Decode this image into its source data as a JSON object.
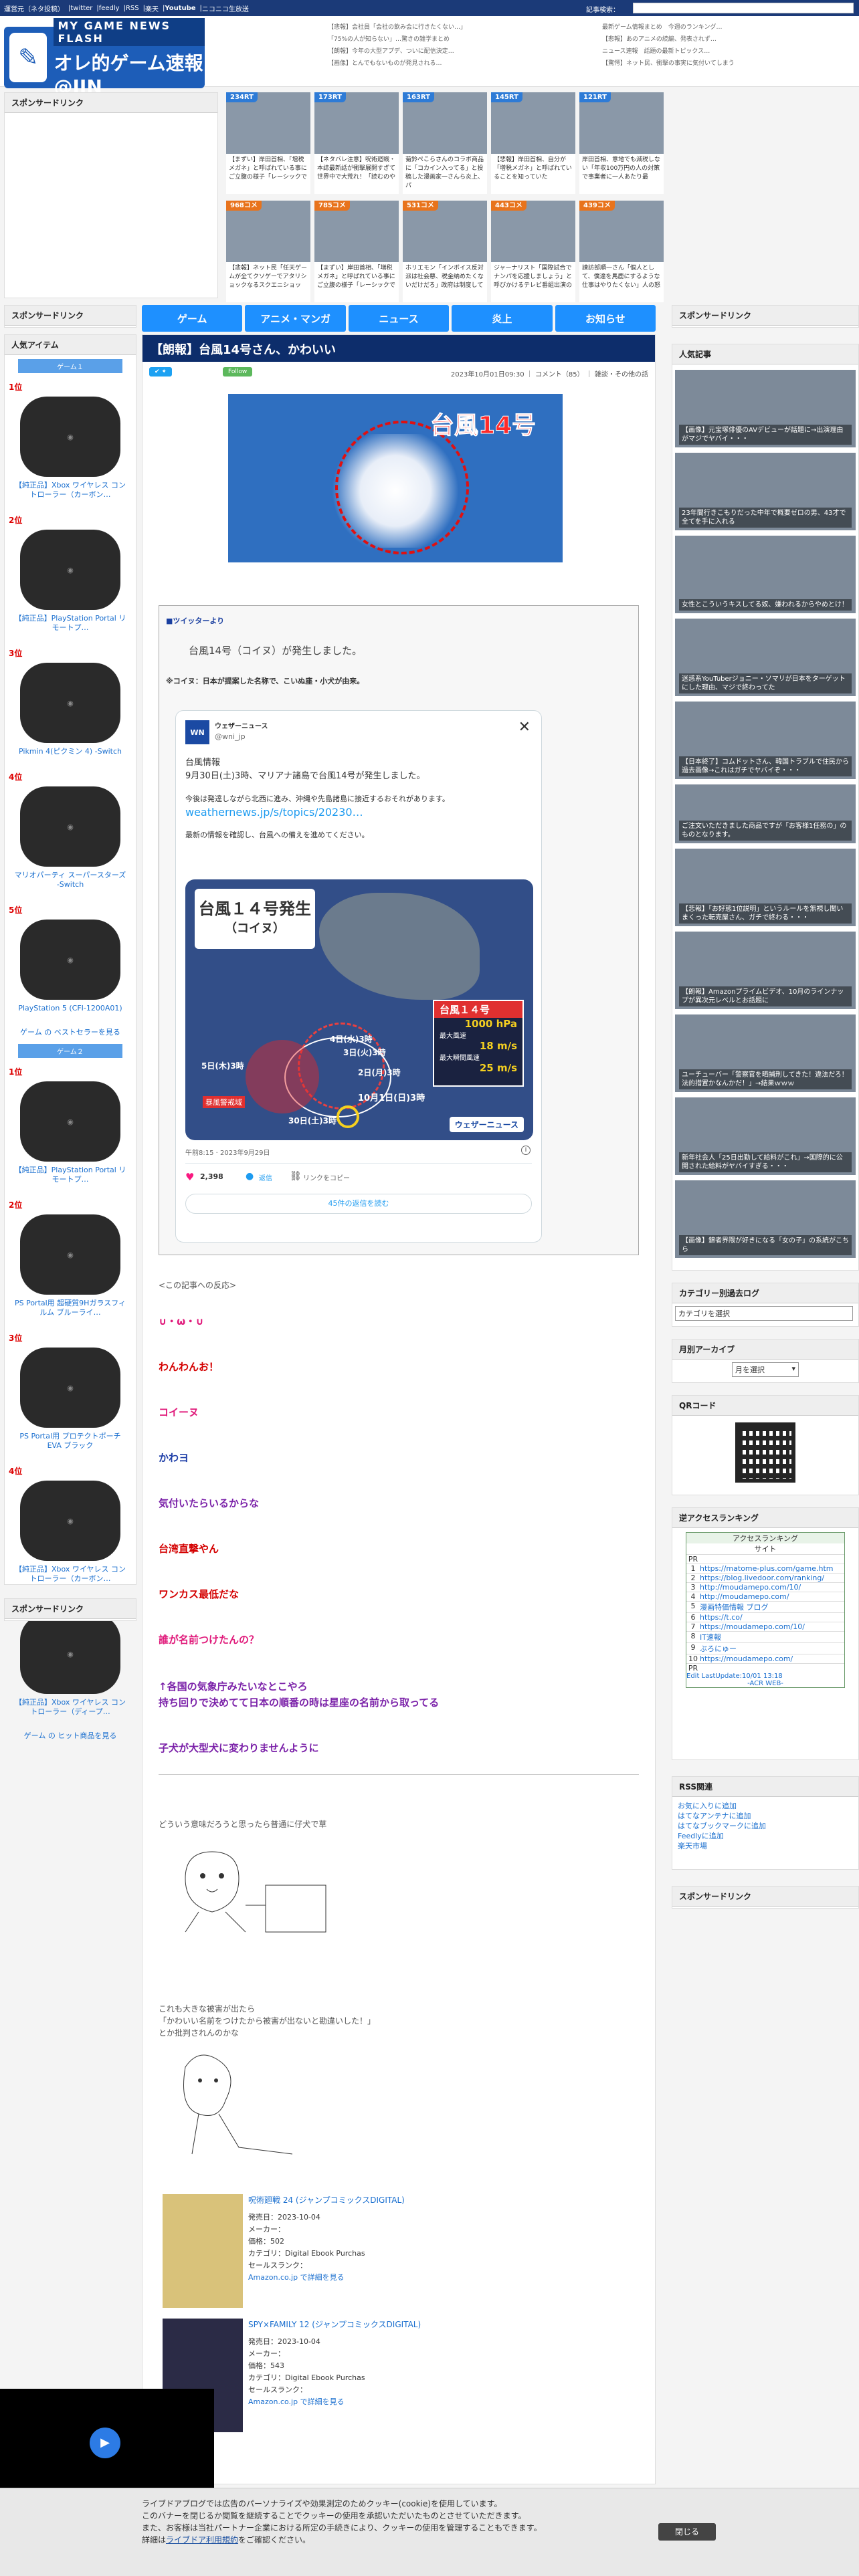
{
  "topbar": {
    "links": [
      "運営元（ネタ投稿）",
      "twitter",
      "feedly",
      "RSS",
      "楽天",
      "Youtube",
      "ニコニコ生放送"
    ],
    "search_label": "記事検索："
  },
  "logo": {
    "line1": "MY GAME NEWS FLASH",
    "line2": "オレ的ゲーム速報@JIN"
  },
  "header_links": [
    "【悲報】会社員「会社の飲み会に行きたくない…」",
    "「75%の人が知らない」…驚きの雑学まとめ",
    "【朗報】今年の大型アプデ、ついに配信決定…",
    "【画像】とんでもないものが発見される…",
    "最新ゲーム情報まとめ　今週のランキング…",
    "【悲報】あのアニメの続編、発表されず…",
    "ニュース速報　話題の最新トピックス…",
    "【驚愕】ネット民、衝撃の事実に気付いてしまう"
  ],
  "sponsor": "スポンサードリンク",
  "top_tiles": [
    {
      "badge": "234RT",
      "caption": "【まずい】岸田首相、「増税メガネ」と呼ばれている事にご立腹の様子「レーシックで"
    },
    {
      "badge": "173RT",
      "caption": "【ネタバレ注意】呪術廻戦・本誌最新話が衝撃展開すぎて世界中で大荒れ！「読むのや"
    },
    {
      "badge": "163RT",
      "caption": "菊鈴ぺこらさんのコラボ商品に「コカイン入ってる」と投稿した漫画家一さんら炎上、パ"
    },
    {
      "badge": "145RT",
      "caption": "【悲報】岸田首相、自分が「増税メガネ」と呼ばれていることを知っていた"
    },
    {
      "badge": "121RT",
      "caption": "岸田首相、意地でも減税しない「年収100万円の人の対策で事業者に一人あたり最"
    },
    {
      "badge": "968コメ",
      "caption": "【悲報】ネット民「任天ゲームが全てクソゲーでアタリショックなるスクエニショッ"
    },
    {
      "badge": "785コメ",
      "caption": "【まずい】岸田首相、「増税メガネ」と呼ばれている事にご立腹の様子「レーシックで"
    },
    {
      "badge": "531コメ",
      "caption": "ホリエモン「インボイス反対派は社会悪、税金納めたくないだけだろ」政府は制度して"
    },
    {
      "badge": "443コメ",
      "caption": "ジャーナリスト「国際試合でナンパを応援しましょう」と呼びかけるテレビ番組出演の"
    },
    {
      "badge": "439コメ",
      "caption": "諫訪部順一さん「個人として、僕達を馬鹿にするような仕事はやりたくない」人の怒"
    }
  ],
  "nav": [
    "ゲーム",
    "アニメ・マンガ",
    "ニュース",
    "炎上",
    "お知らせ"
  ],
  "article": {
    "title": "【朗報】台風14号さん、かわいい",
    "meta": "2023年10月01日09:30 ｜ コメント（85） ｜ 雑談・その他の話",
    "follow": "Follow",
    "hero_text": "台風14号",
    "twitter_from": "■ツイッターより",
    "lead": "台風14号（コイヌ）が発生しました。",
    "lead_highlight": "コイヌ",
    "note": "※コイヌ：日本が提案した名称で、こいぬ座・小犬が由来。",
    "tweet": {
      "name": "ウェザーニュース",
      "handle": "@wni_jp",
      "body1": "台風情報",
      "body2": "9月30日(土)3時、マリアナ諸島で台風14号が発生しました。",
      "body3": "今後は発達しながら北西に進み、沖縄や先島諸島に接近するおそれがあります。",
      "link": "weathernews.jp/s/topics/20230…",
      "body4": "最新の情報を確認し、台風への備えを進めてください。",
      "map_title": "台風１４号発生",
      "map_sub": "（コイヌ）",
      "map_box_title": "台風１４号",
      "pressure": "1000 hPa",
      "wind_label": "最大風速",
      "wind": "18 m/s",
      "gust_label": "最大瞬間風速",
      "gust": "25 m/s",
      "d1": "4日(水)3時",
      "d2": "3日(火)3時",
      "d3": "5日(木)3時",
      "d4": "2日(月)3時",
      "d5": "10月1日(日)3時",
      "d6": "30日(土)3時",
      "storm": "暴風警戒域",
      "brand": "ウェザーニュース",
      "time": "午前8:15 · 2023年9月29日",
      "likes": "2,398",
      "reply": "返信",
      "copy": "リンクをコピー",
      "more": "45件の返信を読む"
    },
    "reactions_label": "<この記事への反応>",
    "comments": [
      {
        "text": "∪・ω・∪",
        "color": "#e0197a"
      },
      {
        "text": "わんわんお！",
        "color": "#d40000"
      },
      {
        "text": "コイーヌ",
        "color": "#e0197a"
      },
      {
        "text": "かわヨ",
        "color": "#1f3fa8"
      },
      {
        "text": "気付いたらいるからな",
        "color": "#7a20a8"
      },
      {
        "text": "台湾直撃やん",
        "color": "#d40000"
      },
      {
        "text": "ワンカス最低だな",
        "color": "#d40000"
      },
      {
        "text": "誰が名前つけたんの？",
        "color": "#e0197a"
      },
      {
        "text": "↑各国の気象庁みたいなとこやろ",
        "color": "#7a20a8"
      },
      {
        "text": "持ち回りで決めてて日本の順番の時は星座の名前から取ってる",
        "color": "#7a20a8"
      },
      {
        "text": "子犬が大型犬に変わりませんように",
        "color": "#7a20a8"
      }
    ],
    "aa1_caption": "どういう意味だろうと思ったら普通に仔犬で草",
    "aa2_caption1": "これも大きな被害が出たら",
    "aa2_caption2": "「かわいい名前をつけたから被害が出ないと勘違いした！」",
    "aa2_caption3": "とか批判されんのかな",
    "books": [
      {
        "title": "呪術廻戦 24 (ジャンプコミックスDIGITAL)",
        "date": "発売日：2023-10-04",
        "maker": "メーカー：",
        "price": "価格：502",
        "category": "カテゴリ：Digital Ebook Purchas",
        "rank": "セールスランク：",
        "link": "Amazon.co.jp で詳細を見る"
      },
      {
        "title": "SPY×FAMILY 12 (ジャンプコミックスDIGITAL)",
        "date": "発売日：2023-10-04",
        "maker": "メーカー：",
        "price": "価格：543",
        "category": "カテゴリ：Digital Ebook Purchas",
        "rank": "セールスランク：",
        "link": "Amazon.co.jp で詳細を見る"
      }
    ]
  },
  "left": {
    "popular": "人気アイテム",
    "tab1": "ゲーム１",
    "tab2": "ゲーム２",
    "items1": [
      {
        "rank": "1位",
        "name": "【純正品】Xbox ワイヤレス コントローラー（カーボン…"
      },
      {
        "rank": "2位",
        "name": "【純正品】PlayStation Portal リモートプ…"
      },
      {
        "rank": "3位",
        "name": "Pikmin 4(ピクミン 4) -Switch"
      },
      {
        "rank": "4位",
        "name": "マリオパーティ スーパースターズ -Switch"
      },
      {
        "rank": "5位",
        "name": "PlayStation 5 (CFI-1200A01)"
      }
    ],
    "best_link": "ゲーム の ベストセラーを見る",
    "items2": [
      {
        "rank": "1位",
        "name": "【純正品】PlayStation Portal リモートプ…"
      },
      {
        "rank": "2位",
        "name": "PS Portal用 超硬質9Hガラスフィルム ブルーライ…"
      },
      {
        "rank": "3位",
        "name": "PS Portal用 プロテクトポーチEVA ブラック"
      },
      {
        "rank": "4位",
        "name": "【純正品】Xbox ワイヤレス コントローラー（カーボン…"
      },
      {
        "rank": "5位",
        "name": "【純正品】Xbox ワイヤレス コントローラー（ディープ…"
      }
    ],
    "hit_link": "ゲーム の ヒット商品を見る"
  },
  "right": {
    "popular": "人気記事",
    "articles": [
      "【画像】元宝塚俳優のAVデビューが話題に→出演理由がマジでヤバイ・・・",
      "23年間行きこもりだった中年で概要ゼロの男、43才で全てを手に入れる",
      "女性とこういうキスしてる奴、嫌われるからやめとけ！",
      "迷惑系YouTuberジョニー・ソマリが日本をターゲットにした理由、マジで終わってた",
      "【日本終了】コムドットさん、韓国トラブルで住民から過去画像→これはガチでヤバイぞ・・・",
      "ご注文いただきました商品ですが「お客様1任務の」のものとなります。",
      "【悲報】「お好態1位説明」というルールを無視し聞いまくった転売屋さん、ガチで終わる・・・",
      "【朗報】Amazonプライムビデオ、10月のラインナップが異次元レベルとお話題に",
      "ユーチューバー「警察官を晒捕刑してきた！違法だろ！法的措置かなんかだ！」→結果ｗｗｗ",
      "新年社会人「25日出勤して給料がこれ」→国際的に公開された給料がヤバイすぎる・・・",
      "【画像】錦者界隈が好きになる「女の子」の系統がこちら"
    ],
    "category_log": "カテゴリー別過去ログ",
    "category_select": "カテゴリを選択",
    "monthly": "月別アーカイブ",
    "month_select": "月を選択",
    "qr": "QRコード",
    "access": "逆アクセスランキング",
    "acc_title": "アクセスランキング",
    "acc_site": "サイト",
    "acc_rows": [
      {
        "n": "PR",
        "s": ""
      },
      {
        "n": "1",
        "s": "https://matome-plus.com/game.htm"
      },
      {
        "n": "2",
        "s": "https://blog.livedoor.com/ranking/"
      },
      {
        "n": "3",
        "s": "http://moudamepo.com/10/"
      },
      {
        "n": "4",
        "s": "http://moudamepo.com/"
      },
      {
        "n": "5",
        "s": "漫画特価情報 ブログ"
      },
      {
        "n": "6",
        "s": "https://t.co/"
      },
      {
        "n": "7",
        "s": "https://moudamepo.com/10/"
      },
      {
        "n": "8",
        "s": "IT速報"
      },
      {
        "n": "9",
        "s": "ぶろにゅー"
      },
      {
        "n": "10",
        "s": "https://moudamepo.com/"
      },
      {
        "n": "PR",
        "s": ""
      }
    ],
    "acc_update": "Edit LastUpdate:10/01 13:18",
    "acc_web": "-ACR WEB-",
    "rss": "RSS関連",
    "rss_links": [
      "お気に入りに追加",
      "はてなアンテナに追加",
      "はてなブックマークに追加",
      "Feedlyに追加",
      "楽天市場"
    ]
  },
  "cookie": {
    "line1": "ライブドアブログでは広告のパーソナライズや効果測定のためクッキー(cookie)を使用しています。",
    "line2": "このバナーを閉じるか閲覧を継続することでクッキーの使用を承認いただいたものとさせていただきます。",
    "line3": "また、お客様は当社パートナー企業における所定の手続きにより、クッキーの使用を管理することもできます。",
    "line4a": "詳細は",
    "line4link": "ライブドア利用規約",
    "line4b": "をご確認ください。",
    "close": "閉じる"
  }
}
